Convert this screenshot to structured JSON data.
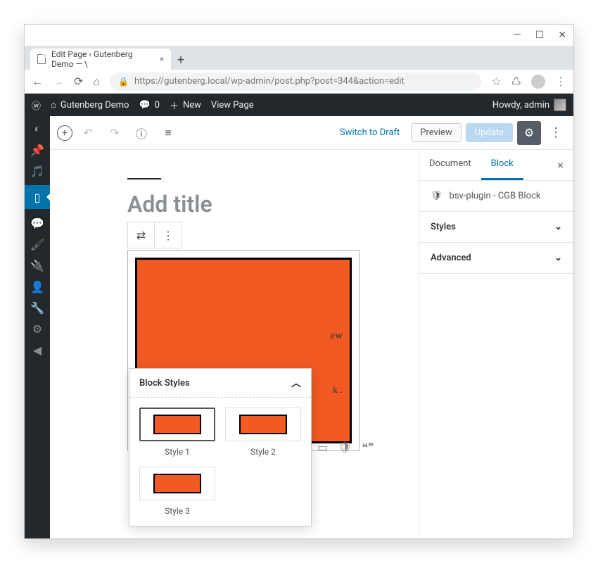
{
  "browser": {
    "tab_title": "Edit Page ‹ Gutenberg Demo — \\",
    "url": "https://gutenberg.local/wp-admin/post.php?post=344&action=edit"
  },
  "wpbar": {
    "site_name": "Gutenberg Demo",
    "comments": "0",
    "new_label": "New",
    "view_page": "View Page",
    "howdy": "Howdy, admin"
  },
  "toolbar": {
    "switch_to_draft": "Switch to Draft",
    "preview": "Preview",
    "update": "Update"
  },
  "editor": {
    "title_placeholder": "Add title",
    "block_bg_text1": "ew",
    "block_bg_text2": "k ."
  },
  "block_styles": {
    "heading": "Block Styles",
    "items": [
      {
        "label": "Style 1",
        "selected": true
      },
      {
        "label": "Style 2",
        "selected": false
      },
      {
        "label": "Style 3",
        "selected": false
      }
    ]
  },
  "sidebar": {
    "tabs": {
      "document": "Document",
      "block": "Block"
    },
    "active_tab": "block",
    "block_name": "bsv-plugin - CGB Block",
    "panels": {
      "styles": "Styles",
      "advanced": "Advanced"
    }
  }
}
